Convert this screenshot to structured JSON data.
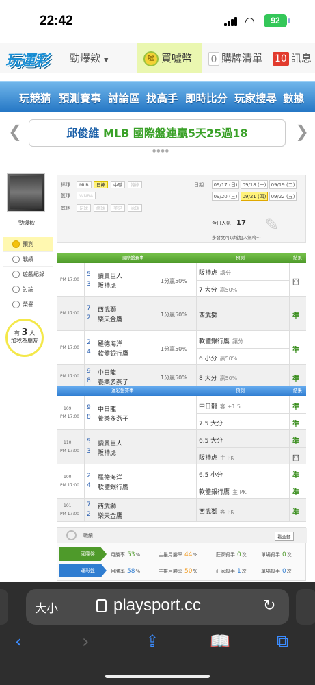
{
  "status": {
    "time": "22:42",
    "battery": "92"
  },
  "nav": {
    "logo": "玩運彩",
    "dropdown": "勁爆欸",
    "coins": "買噓幣",
    "coin_icon": "噓",
    "list_count": "0",
    "list_label": "購牌清單",
    "msg_count": "10",
    "msg_label": "訊息"
  },
  "menu": [
    "玩競猜",
    "預測賽事",
    "討論區",
    "找高手",
    "即時比分",
    "玩家搜尋",
    "數據"
  ],
  "banner": {
    "name": "邱俊維",
    "text": "MLB 國際盤連贏5天25過18"
  },
  "sidebar": {
    "username": "勁爆欸",
    "items": [
      "預測",
      "戰績",
      "遊戲紀錄",
      "討論",
      "榮譽"
    ],
    "bulb_pre": "有",
    "bulb_num": "3",
    "bulb_unit": "人",
    "bulb_post": "加我為朋友"
  },
  "filter": {
    "labels": [
      "棒球",
      "籃球",
      "其他",
      "日期"
    ],
    "baseball": [
      "MLB",
      "日棒",
      "中職",
      "韓棒"
    ],
    "basketball": [
      "WNBA"
    ],
    "other": [
      "足球",
      "網球",
      "美足",
      "冰球"
    ],
    "dates": [
      "09/17 (日)",
      "09/18 (一)",
      "09/19 (二)",
      "09/20 (三)",
      "09/21 (四)",
      "09/22 (五)"
    ],
    "pop_label": "今日人氣",
    "pop_value": "17",
    "pop_tip": "多發文可以增加人氣唷～"
  },
  "intl": {
    "header": [
      "國際盤賽事",
      "預測",
      "結果"
    ],
    "rows": [
      {
        "time": "PM 17:00",
        "n1": "5",
        "t1": "讀賣巨人",
        "n2": "3",
        "t2": "阪神虎",
        "odds": "1分贏50%",
        "p1": "阪神虎",
        "p1s": "讓分",
        "p2": "7 大分",
        "p2s": "贏50%",
        "res": "囧"
      },
      {
        "time": "PM 17:00",
        "n1": "7",
        "t1": "西武獅",
        "n2": "2",
        "t2": "樂天金鷹",
        "odds": "1分贏50%",
        "p1": "西武獅",
        "p1s": "",
        "p2": "",
        "p2s": "",
        "res": "準"
      },
      {
        "time": "PM 17:00",
        "n1": "2",
        "t1": "羅德海洋",
        "n2": "4",
        "t2": "軟體銀行鷹",
        "odds": "1分贏50%",
        "p1": "軟體銀行鷹",
        "p1s": "讓分",
        "p2": "6 小分",
        "p2s": "贏50%",
        "res": "準"
      },
      {
        "time": "PM 17:00",
        "n1": "9",
        "t1": "中日龍",
        "n2": "8",
        "t2": "養樂多燕子",
        "odds": "1分贏50%",
        "p1": "8 大分",
        "p1s": "贏50%",
        "p2": "",
        "p2s": "",
        "res": "準"
      }
    ]
  },
  "local": {
    "header": [
      "運彩盤賽事",
      "預測",
      "結果"
    ],
    "rows": [
      {
        "id": "109",
        "time": "PM 17:00",
        "n1": "9",
        "t1": "中日龍",
        "n2": "8",
        "t2": "養樂多燕子",
        "p1": "中日龍",
        "p1s": "客 +1.5",
        "r1": "準",
        "p2": "7.5 大分",
        "p2s": "",
        "r2": "準"
      },
      {
        "id": "110",
        "time": "PM 17:00",
        "n1": "5",
        "t1": "讀賣巨人",
        "n2": "3",
        "t2": "阪神虎",
        "p1": "6.5 大分",
        "p1s": "",
        "r1": "準",
        "p2": "阪神虎",
        "p2s": "主 PK",
        "r2": "囧"
      },
      {
        "id": "100",
        "time": "PM 17:00",
        "n1": "2",
        "t1": "羅德海洋",
        "n2": "4",
        "t2": "軟體銀行鷹",
        "p1": "6.5 小分",
        "p1s": "",
        "r1": "準",
        "p2": "軟體銀行鷹",
        "p2s": "主 PK",
        "r2": "準"
      },
      {
        "id": "101",
        "time": "PM 17:00",
        "n1": "7",
        "t1": "西武獅",
        "n2": "2",
        "t2": "樂天金鷹",
        "p1": "西武獅",
        "p1s": "客 PK",
        "r1": "準",
        "p2": "",
        "p2s": "",
        "r2": ""
      }
    ]
  },
  "record": {
    "title": "戰績",
    "see_all": "看全部",
    "rows": [
      {
        "label": "國際盤",
        "s1": "月勝率",
        "v1": "53",
        "s2": "主推月勝率",
        "v2": "44",
        "s3": "莊家殺手",
        "v3": "0",
        "s4": "單場殺手",
        "v4": "0"
      },
      {
        "label": "運彩盤",
        "s1": "月勝率",
        "v1": "58",
        "s2": "主推月勝率",
        "v2": "50",
        "s3": "莊家殺手",
        "v3": "1",
        "s4": "單場殺手",
        "v4": "0"
      }
    ],
    "unit_pct": "%",
    "unit_count": "次"
  },
  "safari": {
    "aa": "大小",
    "url": "playsport.cc"
  },
  "colors": {
    "green": "#4e9a2a",
    "blue": "#2f7dd1",
    "accent_yellow": "#fff27a"
  }
}
